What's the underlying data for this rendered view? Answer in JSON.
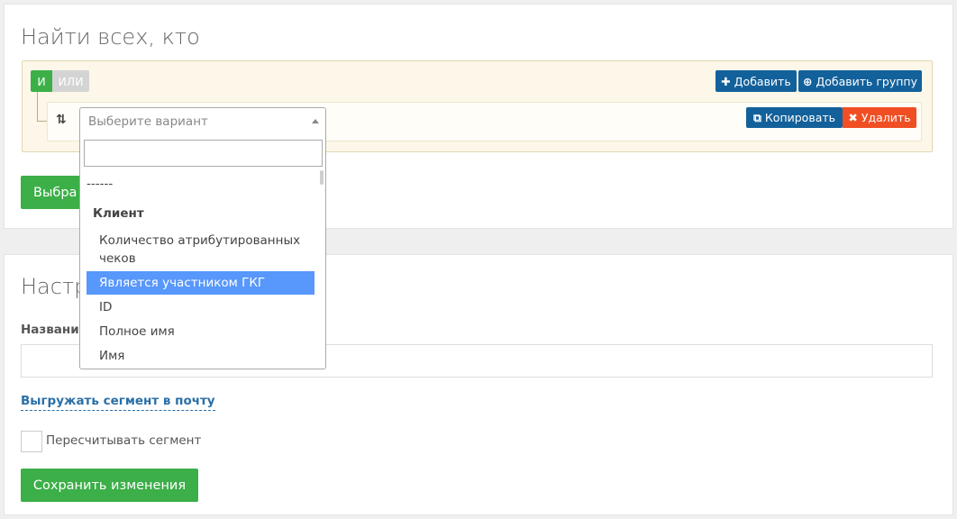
{
  "filter": {
    "title": "Найти всех, кто",
    "and_label": "И",
    "or_label": "ИЛИ",
    "add_label": "Добавить",
    "add_group_label": "Добавить группу",
    "copy_label": "Копировать",
    "delete_label": "Удалить",
    "select_placeholder": "Выберите вариант",
    "select_button_label": "Выбра"
  },
  "dropdown": {
    "search_value": "",
    "separator": "------",
    "group_label": "Клиент",
    "options": [
      "Количество атрибутированных чеков",
      "Является участником ГКГ",
      "ID",
      "Полное имя",
      "Имя"
    ],
    "highlighted_index": 1
  },
  "settings": {
    "title": "Настр",
    "name_label": "Названи",
    "name_value": "",
    "export_link": "Выгружать сегмент в почту",
    "recalc_label": "Пересчитывать сегмент",
    "recalc_checked": false,
    "save_label": "Сохранить изменения"
  },
  "colors": {
    "green": "#3caf48",
    "blue": "#13619b",
    "red": "#f04e23",
    "highlight": "#5897fb"
  }
}
